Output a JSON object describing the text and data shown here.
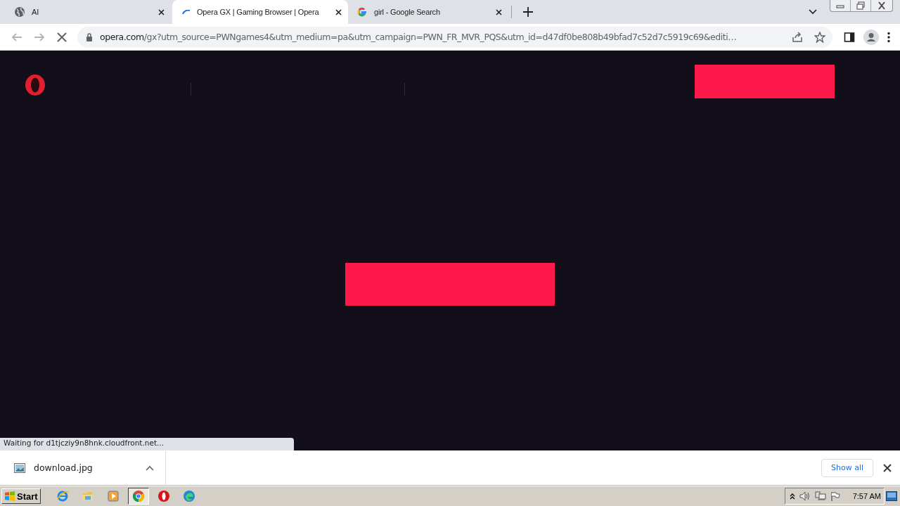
{
  "tabs": [
    {
      "title": "AI",
      "kind": "globe",
      "selected": false
    },
    {
      "title": "Opera GX | Gaming Browser | Opera",
      "kind": "loading",
      "selected": true
    },
    {
      "title": "girl - Google Search",
      "kind": "google",
      "selected": false
    }
  ],
  "address_bar": {
    "url_host": "opera.com",
    "url_rest": "/gx?utm_source=PWNgames4&utm_medium=pa&utm_campaign=PWN_FR_MVR_PQS&utm_id=d47df0be808b49bfad7c52d7c5919c69&editi…",
    "loading": true
  },
  "status_text": "Waiting for d1tjcziy9n8hnk.cloudfront.net...",
  "download_bar": {
    "file": "download.jpg",
    "show_all": "Show all"
  },
  "taskbar": {
    "start": "Start",
    "apps": [
      {
        "kind": "ie",
        "active": false
      },
      {
        "kind": "folder",
        "active": false
      },
      {
        "kind": "media",
        "active": false
      },
      {
        "kind": "chrome",
        "active": true
      },
      {
        "kind": "opera",
        "active": false
      },
      {
        "kind": "edge",
        "active": false
      }
    ],
    "clock": "7:57 AM"
  }
}
